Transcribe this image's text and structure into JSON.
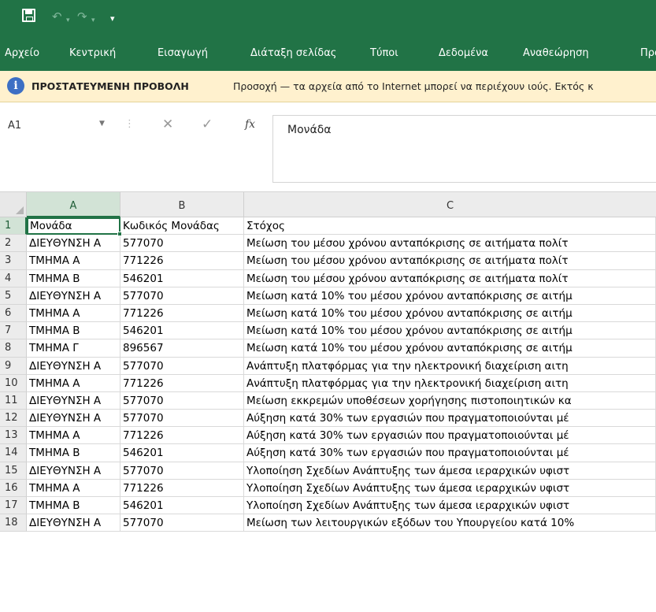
{
  "colors": {
    "brand": "#217346",
    "protected_bg": "#fff1ce"
  },
  "quick_access": {
    "save_icon": "save-icon",
    "undo": "↶",
    "redo": "↷",
    "customize": "▾"
  },
  "ribbon": {
    "tabs": [
      {
        "label": "Αρχείο"
      },
      {
        "label": "Κεντρική"
      },
      {
        "label": "Εισαγωγή"
      },
      {
        "label": "Διάταξη σελίδας"
      },
      {
        "label": "Τύποι"
      },
      {
        "label": "Δεδομένα"
      },
      {
        "label": "Αναθεώρηση"
      },
      {
        "label": "Προ"
      }
    ]
  },
  "protected_view": {
    "icon": "info-icon",
    "title": "ΠΡΟΣΤΑΤΕΥΜΕΝΗ ΠΡΟΒΟΛΗ",
    "message": "Προσοχή — τα αρχεία από το Internet μπορεί να περιέχουν ιούς. Εκτός κ"
  },
  "formula_bar": {
    "name_box": "A1",
    "cancel_symbol": "✕",
    "enter_symbol": "✓",
    "fx_label": "fx",
    "value": "Μονάδα"
  },
  "columns": [
    "A",
    "B",
    "C"
  ],
  "rows": [
    {
      "n": "1",
      "a": "Μονάδα",
      "b": "Κωδικός Μονάδας",
      "c": "Στόχος"
    },
    {
      "n": "2",
      "a": "ΔΙΕΥΘΥΝΣΗ Α",
      "b": "577070",
      "c": "Μείωση του μέσου χρόνου ανταπόκρισης σε αιτήματα πολίτ"
    },
    {
      "n": "3",
      "a": "ΤΜΗΜΑ Α",
      "b": "771226",
      "c": "Μείωση του μέσου χρόνου ανταπόκρισης σε αιτήματα πολίτ"
    },
    {
      "n": "4",
      "a": "ΤΜΗΜΑ Β",
      "b": "546201",
      "c": "Μείωση του μέσου χρόνου ανταπόκρισης σε αιτήματα πολίτ"
    },
    {
      "n": "5",
      "a": "ΔΙΕΥΘΥΝΣΗ Α",
      "b": "577070",
      "c": "Μείωση κατά 10% του μέσου χρόνου ανταπόκρισης σε αιτήμ"
    },
    {
      "n": "6",
      "a": "ΤΜΗΜΑ Α",
      "b": "771226",
      "c": "Μείωση κατά 10% του μέσου χρόνου ανταπόκρισης σε αιτήμ"
    },
    {
      "n": "7",
      "a": "ΤΜΗΜΑ Β",
      "b": "546201",
      "c": "Μείωση κατά 10% του μέσου χρόνου ανταπόκρισης σε αιτήμ"
    },
    {
      "n": "8",
      "a": "ΤΜΗΜΑ Γ",
      "b": "896567",
      "c": "Μείωση κατά 10% του μέσου χρόνου ανταπόκρισης σε αιτήμ"
    },
    {
      "n": "9",
      "a": "ΔΙΕΥΘΥΝΣΗ Α",
      "b": "577070",
      "c": "Ανάπτυξη πλατφόρμας για την ηλεκτρονική διαχείριση αιτη"
    },
    {
      "n": "10",
      "a": "ΤΜΗΜΑ Α",
      "b": "771226",
      "c": "Ανάπτυξη πλατφόρμας για την ηλεκτρονική διαχείριση αιτη"
    },
    {
      "n": "11",
      "a": "ΔΙΕΥΘΥΝΣΗ Α",
      "b": "577070",
      "c": "Μείωση εκκρεμών υποθέσεων χορήγησης πιστοποιητικών κα"
    },
    {
      "n": "12",
      "a": "ΔΙΕΥΘΥΝΣΗ Α",
      "b": "577070",
      "c": "Αύξηση κατά 30% των εργασιών που πραγματοποιούνται μέ"
    },
    {
      "n": "13",
      "a": "ΤΜΗΜΑ Α",
      "b": "771226",
      "c": "Αύξηση κατά 30% των εργασιών που πραγματοποιούνται μέ"
    },
    {
      "n": "14",
      "a": "ΤΜΗΜΑ Β",
      "b": "546201",
      "c": "Αύξηση κατά 30% των εργασιών που πραγματοποιούνται μέ"
    },
    {
      "n": "15",
      "a": "ΔΙΕΥΘΥΝΣΗ Α",
      "b": "577070",
      "c": "Υλοποίηση Σχεδίων Ανάπτυξης των άμεσα ιεραρχικών υφιστ"
    },
    {
      "n": "16",
      "a": "ΤΜΗΜΑ Α",
      "b": "771226",
      "c": "Υλοποίηση Σχεδίων Ανάπτυξης των άμεσα ιεραρχικών υφιστ"
    },
    {
      "n": "17",
      "a": "ΤΜΗΜΑ Β",
      "b": "546201",
      "c": "Υλοποίηση Σχεδίων Ανάπτυξης των άμεσα ιεραρχικών υφιστ"
    },
    {
      "n": "18",
      "a": "ΔΙΕΥΘΥΝΣΗ Α",
      "b": "577070",
      "c": "Μείωση των λειτουργικών εξόδων του Υπουργείου κατά 10%"
    }
  ]
}
